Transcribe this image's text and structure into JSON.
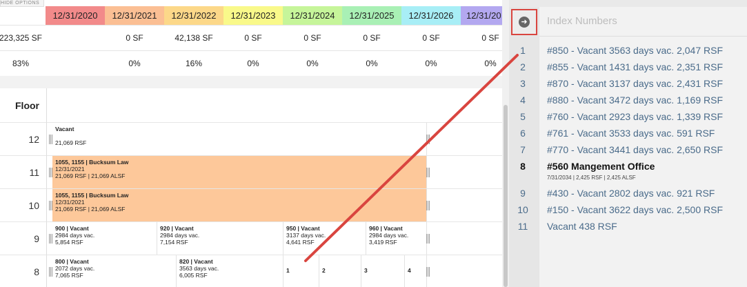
{
  "options": {
    "hide_label": "HIDE OPTIONS"
  },
  "years": [
    {
      "label": "12/31/2020",
      "color": "#f28a8a"
    },
    {
      "label": "12/31/2021",
      "color": "#fbbf94"
    },
    {
      "label": "12/31/2022",
      "color": "#fcd889"
    },
    {
      "label": "12/31/2023",
      "color": "#f9f98a"
    },
    {
      "label": "12/31/2024",
      "color": "#c6f59a"
    },
    {
      "label": "12/31/2025",
      "color": "#a9f0b5"
    },
    {
      "label": "12/31/2026",
      "color": "#a8eef6"
    },
    {
      "label": "12/31/20",
      "color": "#b3a8f0"
    }
  ],
  "sf_values": [
    "223,325 SF",
    "0 SF",
    "42,138 SF",
    "0 SF",
    "0 SF",
    "0 SF",
    "0 SF",
    "0 SF"
  ],
  "pct_values": [
    "83%",
    "0%",
    "16%",
    "0%",
    "0%",
    "0%",
    "0%",
    "0%"
  ],
  "floor_header": "Floor",
  "floors": {
    "f12": {
      "num": "12",
      "suites": [
        {
          "title": "Vacant",
          "lines": [
            "",
            "21,069 RSF"
          ]
        }
      ]
    },
    "f11": {
      "num": "11",
      "suites": [
        {
          "title": "1055, 1155 | Bucksum Law",
          "lines": [
            "12/31/2021",
            "21,069 RSF | 21,069 ALSF"
          ]
        }
      ]
    },
    "f10": {
      "num": "10",
      "suites": [
        {
          "title": "1055, 1155 | Bucksum Law",
          "lines": [
            "12/31/2021",
            "21,069 RSF | 21,069 ALSF"
          ]
        }
      ]
    },
    "f9": {
      "num": "9",
      "suites": [
        {
          "title": "900 | Vacant",
          "lines": [
            "2984 days vac.",
            "5,854 RSF"
          ]
        },
        {
          "title": "920 | Vacant",
          "lines": [
            "2984 days vac.",
            "7,154 RSF"
          ]
        },
        {
          "title": "950 | Vacant",
          "lines": [
            "3137 days vac.",
            "4,641 RSF"
          ]
        },
        {
          "title": "960 | Vacant",
          "lines": [
            "2984 days vac.",
            "3,419 RSF"
          ]
        }
      ]
    },
    "f8": {
      "num": "8",
      "suites": [
        {
          "title": "800 | Vacant",
          "lines": [
            "2072 days vac.",
            "7,065 RSF"
          ]
        },
        {
          "title": "820 | Vacant",
          "lines": [
            "3563 days vac.",
            "6,005 RSF"
          ]
        },
        {
          "title": "1",
          "lines": []
        },
        {
          "title": "2",
          "lines": []
        },
        {
          "title": "3",
          "lines": []
        },
        {
          "title": "4",
          "lines": []
        }
      ]
    }
  },
  "colors": {
    "lease_fill": "#fdc89a",
    "accent_red": "#d9453f",
    "index_link": "#4a6b8a"
  },
  "panel": {
    "title": "Index Numbers",
    "arrow_icon": "arrow-right-circle-icon",
    "items": [
      {
        "num": "1",
        "text": "#850 - Vacant   3563 days vac. 2,047 RSF"
      },
      {
        "num": "2",
        "text": "#855 - Vacant   1431 days vac. 2,351 RSF"
      },
      {
        "num": "3",
        "text": "#870 - Vacant   3137 days vac. 2,431 RSF"
      },
      {
        "num": "4",
        "text": "#880 - Vacant   3472 days vac. 1,169 RSF"
      },
      {
        "num": "5",
        "text": "#760 - Vacant   2923 days vac. 1,339 RSF"
      },
      {
        "num": "6",
        "text": "#761 - Vacant   3533 days vac. 591 RSF"
      },
      {
        "num": "7",
        "text": "#770 - Vacant   3441 days vac. 2,650 RSF"
      },
      {
        "num": "8",
        "text": "#560   Mangement Office",
        "sub": "7/31/2034 | 2,425 RSF | 2,425 ALSF"
      },
      {
        "num": "9",
        "text": "#430 - Vacant   2802 days vac. 921 RSF"
      },
      {
        "num": "10",
        "text": "#150 - Vacant   3622 days vac. 2,500 RSF"
      },
      {
        "num": "11",
        "text": "Vacant   438 RSF"
      }
    ]
  }
}
